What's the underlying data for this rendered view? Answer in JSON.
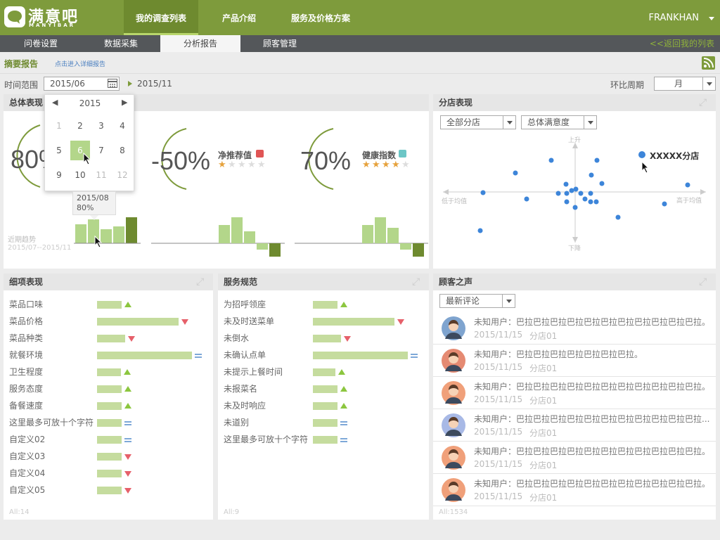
{
  "header": {
    "logo_name": "满意吧",
    "logo_sub": "MANYIBAR",
    "nav": [
      "我的调查列表",
      "产品介绍",
      "服务及价格方案"
    ],
    "user": "FRANKHAN"
  },
  "tabs": [
    "问卷设置",
    "数据采集",
    "分析报告",
    "顾客管理"
  ],
  "back_link": "<<返回我的列表",
  "sub": {
    "summary": "摘要报告",
    "detail_link": "点击进入详细报告"
  },
  "filter": {
    "range_label": "时间范围",
    "range_value": "2015/06",
    "range_end": "2015/11",
    "period_label": "环比周期",
    "period_value": "月"
  },
  "calendar": {
    "year": "2015",
    "months": [
      "1",
      "2",
      "3",
      "4",
      "5",
      "6",
      "7",
      "8",
      "9",
      "10",
      "11",
      "12"
    ],
    "tooltip_date": "2015/08",
    "tooltip_value": "80%"
  },
  "overall": {
    "title": "总体表现",
    "kpi1": "80%",
    "kpi2_value": "-50%",
    "kpi2_label": "净推荐值",
    "kpi2_stars": 1,
    "kpi3_value": "70%",
    "kpi3_label": "健康指数",
    "kpi3_stars": 4,
    "trend_label": "近期趋势",
    "trend_range": "2015/07--2015/11",
    "colors": {
      "accent": "#7e9b3c",
      "bar_light": "#b3d68a",
      "bar_dark": "#6e8a2f",
      "nps_badge": "#e05555",
      "health_badge": "#6cc6c6"
    }
  },
  "branch": {
    "title": "分店表现",
    "filter1": "全部分店",
    "filter2": "总体满意度",
    "axis_up": "上升",
    "axis_down": "下降",
    "axis_left": "低于均值",
    "axis_right": "高于均值",
    "highlight": "XXXXX分店"
  },
  "detail": {
    "title": "细项表现",
    "items": [
      {
        "label": "菜品口味",
        "trend": "up"
      },
      {
        "label": "菜品价格",
        "trend": "down"
      },
      {
        "label": "菜品种类",
        "trend": "down"
      },
      {
        "label": "就餐环境",
        "trend": "flat"
      },
      {
        "label": "卫生程度",
        "trend": "up"
      },
      {
        "label": "服务态度",
        "trend": "up"
      },
      {
        "label": "备餐速度",
        "trend": "up"
      },
      {
        "label": "这里最多可放十个字符",
        "trend": "flat"
      },
      {
        "label": "自定义02",
        "trend": "flat"
      },
      {
        "label": "自定义03",
        "trend": "down"
      },
      {
        "label": "自定义04",
        "trend": "down"
      },
      {
        "label": "自定义05",
        "trend": "down"
      }
    ],
    "footer": "All:14"
  },
  "service": {
    "title": "服务规范",
    "items": [
      {
        "label": "为招呼领座",
        "trend": "up"
      },
      {
        "label": "未及时送菜单",
        "trend": "down"
      },
      {
        "label": "未倒水",
        "trend": "down"
      },
      {
        "label": "未确认点单",
        "trend": "flat"
      },
      {
        "label": "未提示上餐时间",
        "trend": "up"
      },
      {
        "label": "未报菜名",
        "trend": "up"
      },
      {
        "label": "未及时响应",
        "trend": "up"
      },
      {
        "label": "未道别",
        "trend": "flat"
      },
      {
        "label": "这里最多可放十个字符",
        "trend": "flat"
      }
    ],
    "footer": "All:9"
  },
  "voice": {
    "title": "顾客之声",
    "filter": "最新评论",
    "comments": [
      {
        "text": "未知用户：巴拉巴拉巴拉巴拉巴拉巴拉巴拉巴拉巴拉巴拉巴拉。",
        "date": "2015/11/15",
        "shop": "分店01",
        "avatar_color": "#7fa4cf"
      },
      {
        "text": "未知用户：巴拉巴拉巴拉巴拉巴拉巴拉巴拉。",
        "date": "2015/11/15",
        "shop": "分店01",
        "avatar_color": "#e58a72"
      },
      {
        "text": "未知用户：巴拉巴拉巴拉巴拉巴拉巴拉巴拉巴拉巴拉巴拉巴拉。",
        "date": "2015/11/15",
        "shop": "分店01",
        "avatar_color": "#f0a07a"
      },
      {
        "text": "未知用户：巴拉巴拉巴拉巴拉巴拉巴拉巴拉巴拉巴拉巴拉巴拉...",
        "date": "2015/11/15",
        "shop": "分店01",
        "avatar_color": "#a8b9e6"
      },
      {
        "text": "未知用户：巴拉巴拉巴拉巴拉巴拉巴拉巴拉巴拉巴拉巴拉巴拉。",
        "date": "2015/11/15",
        "shop": "分店01",
        "avatar_color": "#f0a07a"
      },
      {
        "text": "未知用户：巴拉巴拉巴拉巴拉巴拉巴拉巴拉巴拉巴拉巴拉巴拉。",
        "date": "2015/11/15",
        "shop": "分店01",
        "avatar_color": "#f0a07a"
      }
    ],
    "footer": "All:1534"
  }
}
